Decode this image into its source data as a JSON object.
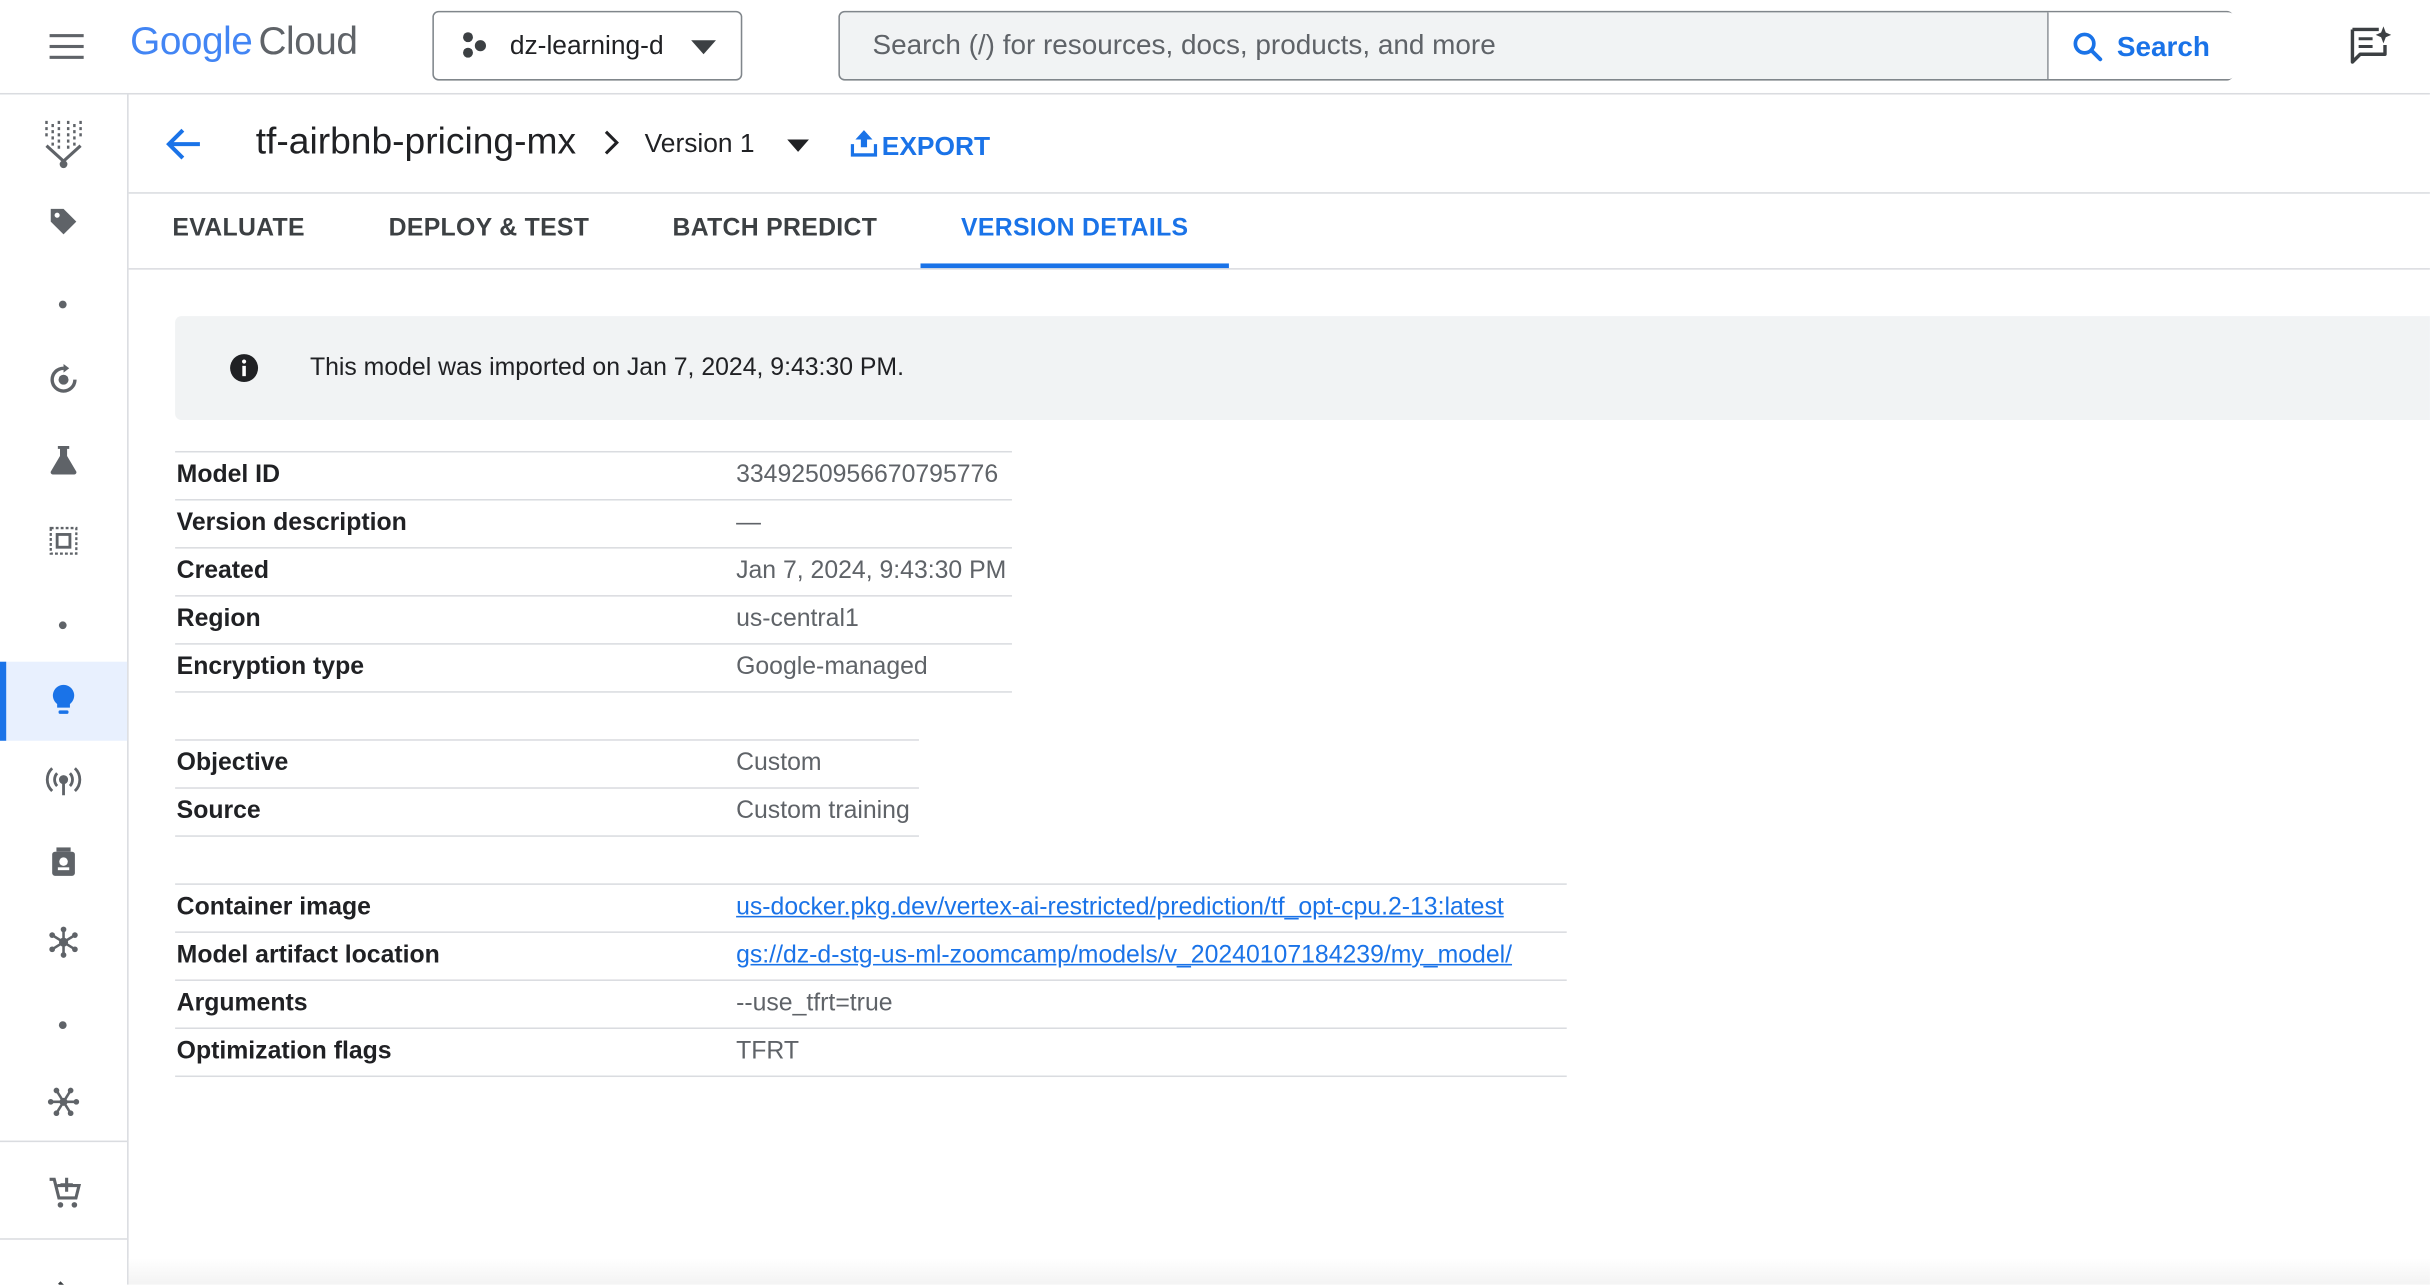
{
  "topbar": {
    "logo_google": "Google",
    "logo_cloud": "Cloud",
    "project": "dz-learning-d",
    "search_placeholder": "Search (/) for resources, docs, products, and more",
    "search_button": "Search"
  },
  "header": {
    "model_name": "tf-airbnb-pricing-mx",
    "version": "Version 1",
    "export": "EXPORT"
  },
  "tabs": [
    {
      "label": "EVALUATE",
      "active": false
    },
    {
      "label": "DEPLOY & TEST",
      "active": false
    },
    {
      "label": "BATCH PREDICT",
      "active": false
    },
    {
      "label": "VERSION DETAILS",
      "active": true
    }
  ],
  "banner": {
    "message": "This model was imported on Jan 7, 2024, 9:43:30 PM."
  },
  "details": {
    "general": [
      {
        "key": "Model ID",
        "value": "3349250956670795776"
      },
      {
        "key": "Version description",
        "value": "—"
      },
      {
        "key": "Created",
        "value": "Jan 7, 2024, 9:43:30 PM"
      },
      {
        "key": "Region",
        "value": "us-central1"
      },
      {
        "key": "Encryption type",
        "value": "Google-managed"
      }
    ],
    "training": [
      {
        "key": "Objective",
        "value": "Custom"
      },
      {
        "key": "Source",
        "value": "Custom training"
      }
    ],
    "container": [
      {
        "key": "Container image",
        "value": "us-docker.pkg.dev/vertex-ai-restricted/prediction/tf_opt-cpu.2-13:latest"
      },
      {
        "key": "Model artifact location",
        "value": "gs://dz-d-stg-us-ml-zoomcamp/models/v_20240107184239/my_model/"
      },
      {
        "key": "Arguments",
        "value": "--use_tfrt=true"
      },
      {
        "key": "Optimization flags",
        "value": "TFRT"
      }
    ]
  },
  "colors": {
    "accent": "#1a73e8",
    "text": "#202124",
    "muted": "#5f6368",
    "divider": "#dadce0",
    "banner_bg": "#f1f3f4"
  },
  "rail_icons": [
    "vertex-ai-icon",
    "tag-icon",
    "pipelines-icon",
    "experiments-icon",
    "workbench-icon",
    "model-registry-icon",
    "endpoints-icon",
    "feature-store-icon",
    "matching-engine-icon",
    "metadata-icon",
    "marketplace-icon"
  ]
}
